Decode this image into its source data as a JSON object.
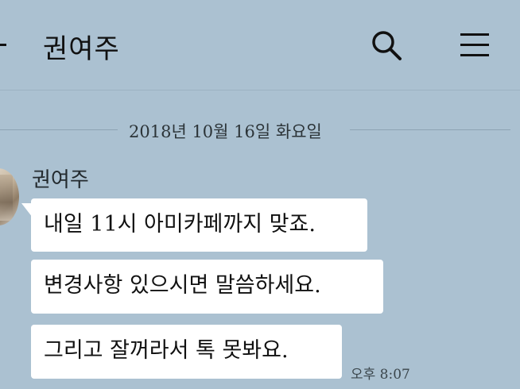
{
  "header": {
    "back_icon": "back-arrow-icon",
    "title": "권여주",
    "search_icon": "search-icon",
    "menu_icon": "hamburger-menu-icon"
  },
  "chat": {
    "date_divider": "2018년 10월 16일 화요일",
    "sender": {
      "name": "권여주",
      "avatar_icon": "profile-avatar"
    },
    "messages": [
      {
        "text": "내일 11시 아미카페까지 맞죠."
      },
      {
        "text": "변경사항 있으시면 말씀하세요."
      },
      {
        "text": "그리고 잘꺼라서 톡 못봐요."
      }
    ],
    "last_timestamp": "오후 8:07"
  },
  "colors": {
    "background": "#abc1d1",
    "bubble": "#ffffff",
    "divider_line": "#8ea3b3"
  }
}
